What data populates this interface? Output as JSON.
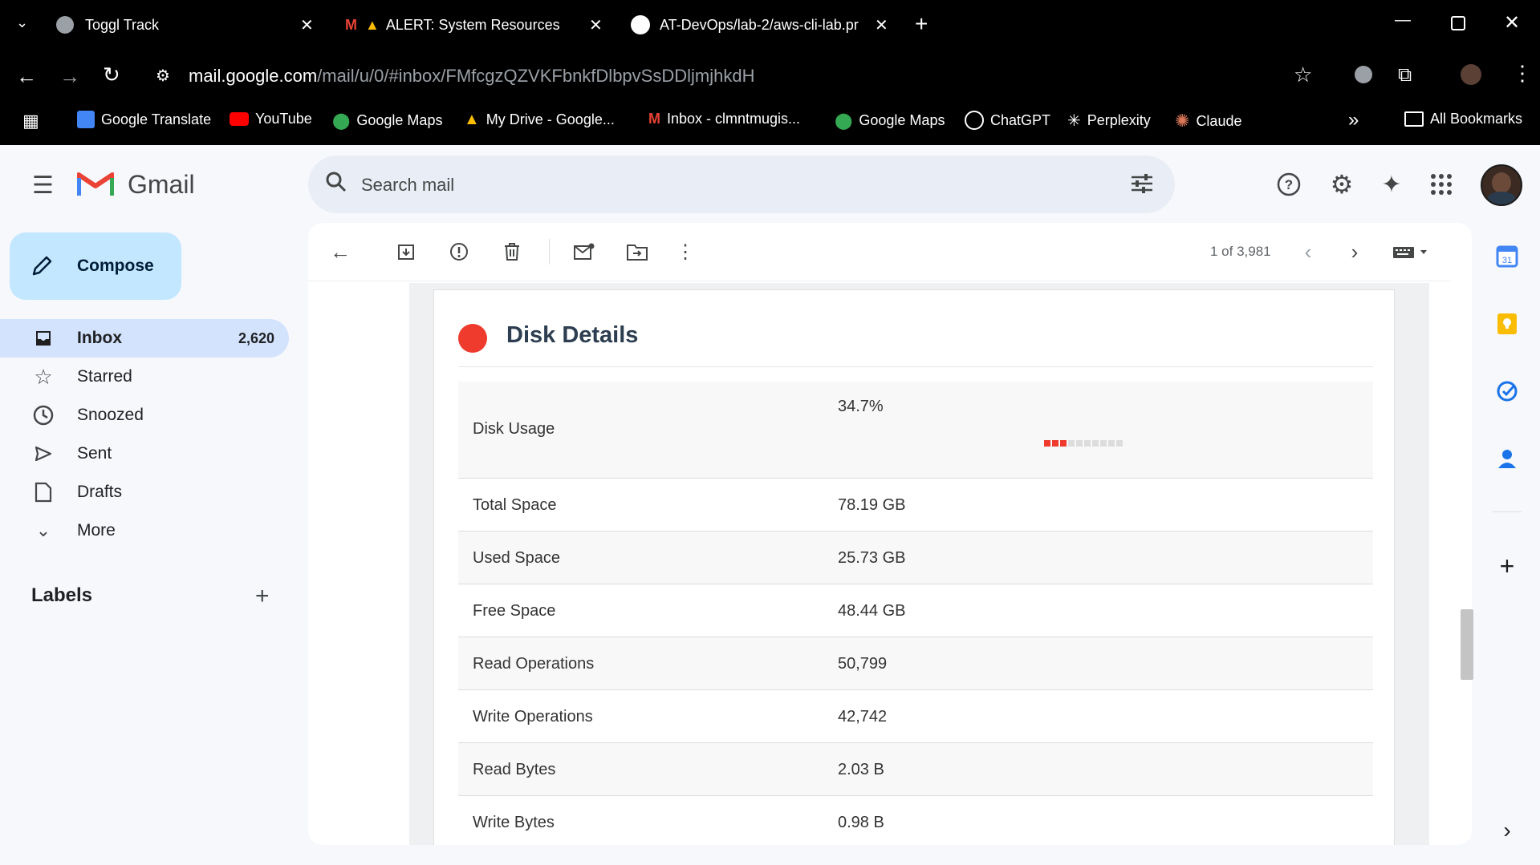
{
  "browser": {
    "tabs": [
      {
        "title": "Toggl Track"
      },
      {
        "title": "ALERT: System Resources Cr"
      },
      {
        "title": "AT-DevOps/lab-2/aws-cli-lab.pr"
      }
    ],
    "url_host": "mail.google.com",
    "url_path": "/mail/u/0/#inbox/FMfcgzQZVKFbnkfDlbpvSsDDljmjhkdH",
    "bookmarks": [
      "Google Translate",
      "YouTube",
      "Google Maps",
      "My Drive - Google...",
      "Inbox - clmntmugis...",
      "Google Maps",
      "ChatGPT",
      "Perplexity",
      "Claude"
    ],
    "all_bookmarks": "All Bookmarks"
  },
  "gmail": {
    "logo": "Gmail",
    "search_placeholder": "Search mail",
    "compose": "Compose",
    "nav": [
      {
        "label": "Inbox",
        "count": "2,620"
      },
      {
        "label": "Starred",
        "count": ""
      },
      {
        "label": "Snoozed",
        "count": ""
      },
      {
        "label": "Sent",
        "count": ""
      },
      {
        "label": "Drafts",
        "count": ""
      },
      {
        "label": "More",
        "count": ""
      }
    ],
    "labels_heading": "Labels",
    "pager": "1 of 3,981"
  },
  "email": {
    "section_title": "Disk Details",
    "usage_fraction": 0.347,
    "rows": [
      {
        "key": "Disk Usage",
        "value": "34.7%"
      },
      {
        "key": "Total Space",
        "value": "78.19 GB"
      },
      {
        "key": "Used Space",
        "value": "25.73 GB"
      },
      {
        "key": "Free Space",
        "value": "48.44 GB"
      },
      {
        "key": "Read Operations",
        "value": "50,799"
      },
      {
        "key": "Write Operations",
        "value": "42,742"
      },
      {
        "key": "Read Bytes",
        "value": "2.03 B"
      },
      {
        "key": "Write Bytes",
        "value": "0.98 B"
      }
    ]
  },
  "colors": {
    "accent_red": "#ef3b2d",
    "compose_bg": "#c2e7ff",
    "nav_active": "#d3e3fd"
  }
}
